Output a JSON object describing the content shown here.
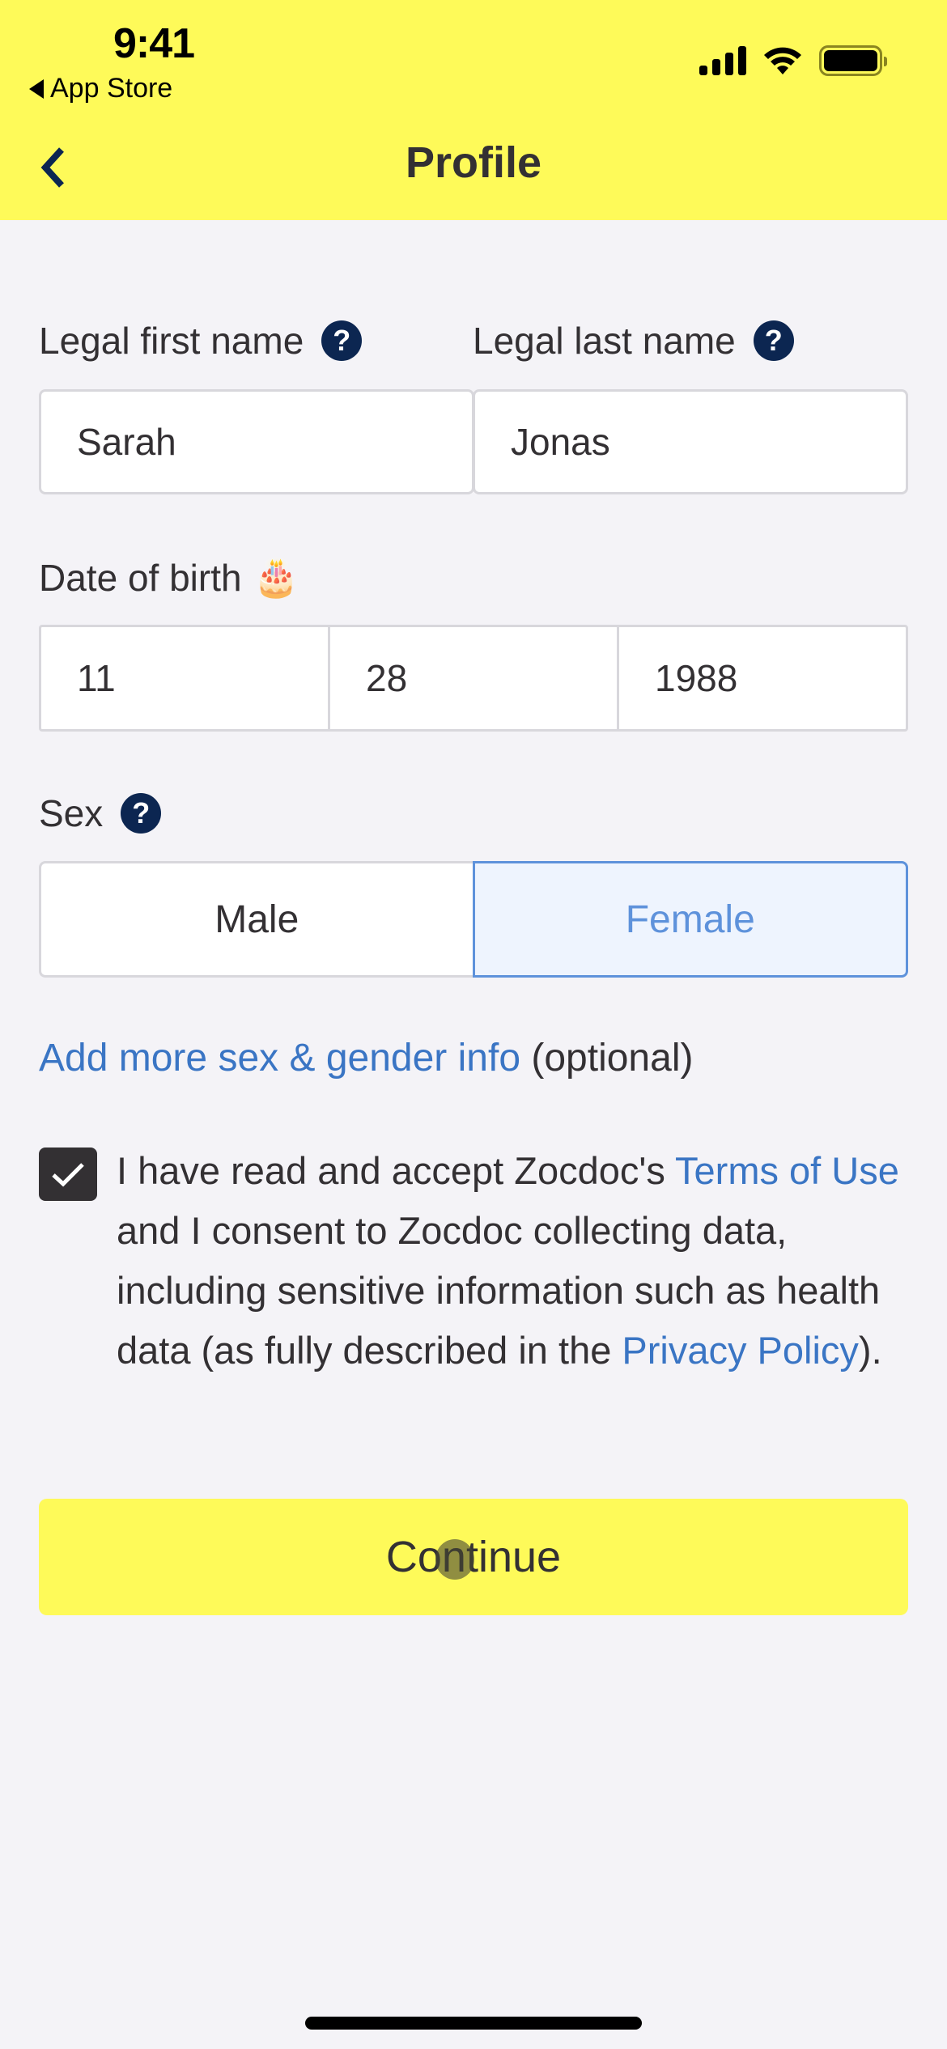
{
  "status_bar": {
    "time": "9:41",
    "back_app": "App Store",
    "icons": [
      "cellular-signal-icon",
      "wifi-icon",
      "battery-icon"
    ]
  },
  "nav": {
    "title": "Profile",
    "back_icon": "chevron-left-icon"
  },
  "form": {
    "first_name": {
      "label": "Legal first name",
      "value": "Sarah",
      "help_icon": "?"
    },
    "last_name": {
      "label": "Legal last name",
      "value": "Jonas",
      "help_icon": "?"
    },
    "dob": {
      "label": "Date of birth",
      "emoji": "🎂",
      "month": "11",
      "day": "28",
      "year": "1988"
    },
    "sex": {
      "label": "Sex",
      "help_icon": "?",
      "options": [
        "Male",
        "Female"
      ],
      "selected": "Female"
    },
    "gender_link": "Add more sex & gender info",
    "gender_optional": "(optional)",
    "consent": {
      "checked": true,
      "text_1": "I have read and accept Zocdoc's ",
      "terms_link": "Terms of Use",
      "text_2": " and I consent to Zocdoc collecting data, including sensitive information such as health data (as fully described in the ",
      "privacy_link": "Privacy Policy",
      "text_3": ")."
    },
    "continue_label": "Continue"
  },
  "colors": {
    "brand_yellow": "#fefa59",
    "link_blue": "#3a75c4",
    "selected_blue": "#5e92db",
    "help_navy": "#0c2651",
    "text_dark": "#333033",
    "background": "#f4f3f7"
  }
}
